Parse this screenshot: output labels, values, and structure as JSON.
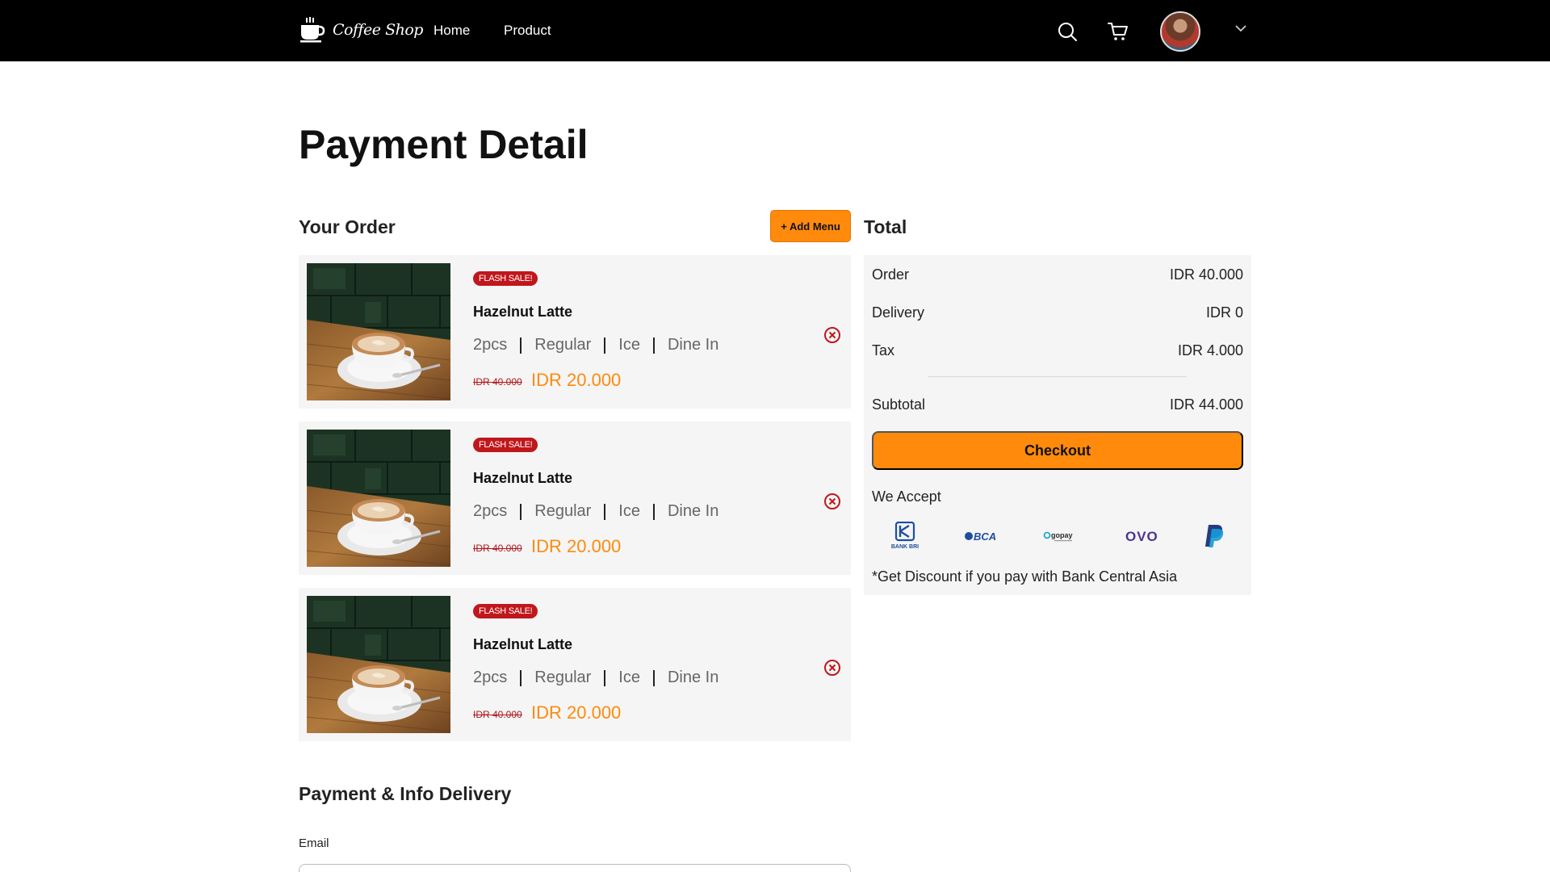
{
  "nav": {
    "brand": "Coffee Shop",
    "links": [
      {
        "label": "Home"
      },
      {
        "label": "Product"
      }
    ],
    "icons": [
      "search-icon",
      "cart-icon",
      "chevron-down-icon"
    ]
  },
  "page": {
    "title": "Payment Detail"
  },
  "order": {
    "title": "Your Order",
    "add_menu_label": "+ Add Menu",
    "items": [
      {
        "badge": "FLASH SALE!",
        "name": "Hazelnut Latte",
        "qty": "2pcs",
        "size": "Regular",
        "temp": "Ice",
        "service": "Dine In",
        "old_price": "IDR 40.000",
        "price": "IDR 20.000"
      },
      {
        "badge": "FLASH SALE!",
        "name": "Hazelnut Latte",
        "qty": "2pcs",
        "size": "Regular",
        "temp": "Ice",
        "service": "Dine In",
        "old_price": "IDR 40.000",
        "price": "IDR 20.000"
      },
      {
        "badge": "FLASH SALE!",
        "name": "Hazelnut Latte",
        "qty": "2pcs",
        "size": "Regular",
        "temp": "Ice",
        "service": "Dine In",
        "old_price": "IDR 40.000",
        "price": "IDR 20.000"
      }
    ]
  },
  "total": {
    "title": "Total",
    "rows": [
      {
        "label": "Order",
        "value": "IDR 40.000"
      },
      {
        "label": "Delivery",
        "value": "IDR 0"
      },
      {
        "label": "Tax",
        "value": "IDR 4.000"
      }
    ],
    "subtotal": {
      "label": "Subtotal",
      "value": "IDR 44.000"
    },
    "checkout_label": "Checkout",
    "we_accept": "We Accept",
    "payment_methods": [
      {
        "name": "BANK BRI",
        "icon": "bri-logo"
      },
      {
        "name": "BCA",
        "icon": "bca-logo"
      },
      {
        "name": "gopay",
        "icon": "gopay-logo"
      },
      {
        "name": "OVO",
        "icon": "ovo-logo"
      },
      {
        "name": "PayPal",
        "icon": "paypal-logo"
      }
    ],
    "discount_note": "*Get Discount if you pay with Bank Central Asia"
  },
  "payment": {
    "title": "Payment & Info Delivery",
    "email_label": "Email"
  },
  "colors": {
    "accent": "#ff8a0b",
    "flash": "#c0171c",
    "navbar": "#000000",
    "panel": "#f5f5f5"
  }
}
